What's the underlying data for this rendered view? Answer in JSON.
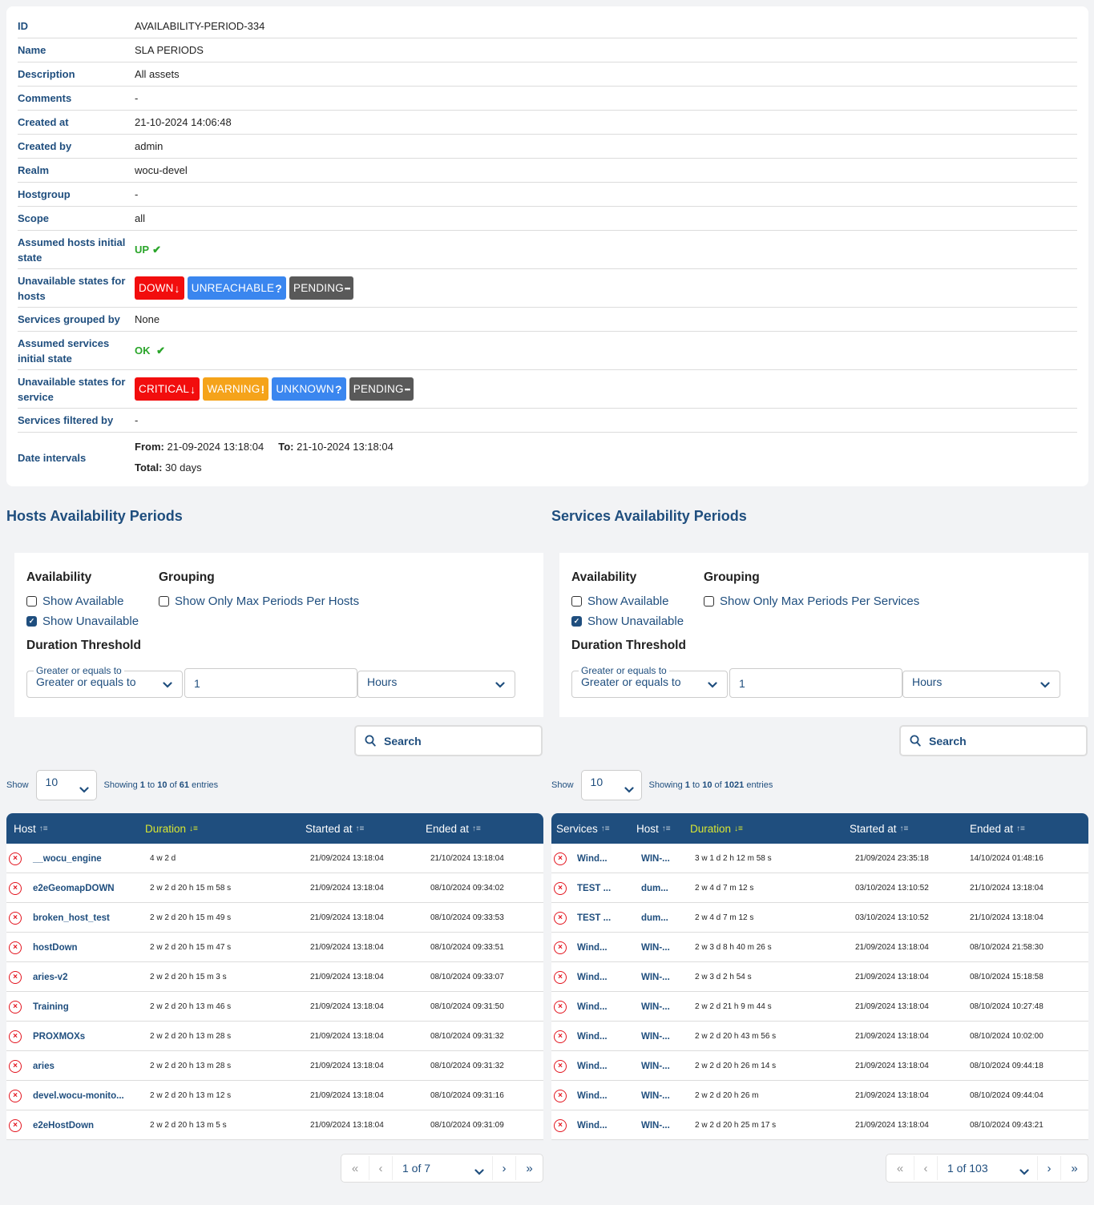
{
  "details": {
    "rows": [
      {
        "label": "ID",
        "value": "AVAILABILITY-PERIOD-334"
      },
      {
        "label": "Name",
        "value": "SLA PERIODS"
      },
      {
        "label": "Description",
        "value": "All assets"
      },
      {
        "label": "Comments",
        "value": "-"
      },
      {
        "label": "Created at",
        "value": "21-10-2024 14:06:48"
      },
      {
        "label": "Created by",
        "value": "admin"
      },
      {
        "label": "Realm",
        "value": "wocu-devel"
      },
      {
        "label": "Hostgroup",
        "value": "-"
      },
      {
        "label": "Scope",
        "value": "all"
      }
    ],
    "assumed_hosts_label": "Assumed hosts initial state",
    "assumed_hosts_value": "UP",
    "unavailable_hosts_label": "Unavailable states for hosts",
    "unavailable_hosts_badges": [
      {
        "label": "DOWN",
        "icon": "arrow-down-icon",
        "glyph": "↓",
        "color": "#f20d0d"
      },
      {
        "label": "UNREACHABLE",
        "icon": "question-icon",
        "glyph": "?",
        "color": "#3a86ef"
      },
      {
        "label": "PENDING",
        "icon": "ellipsis-icon",
        "glyph": "•••",
        "color": "#595959"
      }
    ],
    "services_grouped_label": "Services grouped by",
    "services_grouped_value": "None",
    "assumed_services_label": "Assumed services initial state",
    "assumed_services_value": "OK",
    "unavailable_services_label": "Unavailable states for service",
    "unavailable_services_badges": [
      {
        "label": "CRITICAL",
        "icon": "arrow-down-icon",
        "glyph": "↓",
        "color": "#f20d0d"
      },
      {
        "label": "WARNING",
        "icon": "exclamation-icon",
        "glyph": "!",
        "color": "#f5a31a"
      },
      {
        "label": "UNKNOWN",
        "icon": "question-icon",
        "glyph": "?",
        "color": "#3a86ef"
      },
      {
        "label": "PENDING",
        "icon": "ellipsis-icon",
        "glyph": "•••",
        "color": "#595959"
      }
    ],
    "services_filtered_label": "Services filtered by",
    "services_filtered_value": "-",
    "date_intervals_label": "Date intervals",
    "from_label": "From:",
    "from_value": "21-09-2024 13:18:04",
    "to_label": "To:",
    "to_value": "21-10-2024 13:18:04",
    "total_label": "Total:",
    "total_value": "30 days"
  },
  "hosts": {
    "title": "Hosts Availability Periods",
    "availability_heading": "Availability",
    "show_available": {
      "label": "Show Available",
      "checked": false
    },
    "show_unavailable": {
      "label": "Show Unavailable",
      "checked": true
    },
    "grouping_heading": "Grouping",
    "max_periods": {
      "label": "Show Only Max Periods Per Hosts",
      "checked": false
    },
    "duration_heading": "Duration Threshold",
    "operator_legend": "Greater or equals to",
    "operator_value": "Greater or equals to",
    "threshold_value": "1",
    "unit_value": "Hours",
    "search_label": "Search",
    "show_label": "Show",
    "page_size": "10",
    "showing_prefix": "Showing",
    "showing_from": "1",
    "showing_to_word": "to",
    "showing_to": "10",
    "showing_of_word": "of",
    "showing_total": "61",
    "showing_suffix": "entries",
    "columns": [
      "Host",
      "Duration",
      "Started at",
      "Ended at"
    ],
    "sorted_column": "Duration",
    "rows": [
      {
        "host": "__wocu_engine",
        "duration": "4 w 2 d",
        "started": "21/09/2024 13:18:04",
        "ended": "21/10/2024 13:18:04"
      },
      {
        "host": "e2eGeomapDOWN",
        "duration": "2 w 2 d 20 h 15 m 58 s",
        "started": "21/09/2024 13:18:04",
        "ended": "08/10/2024 09:34:02"
      },
      {
        "host": "broken_host_test",
        "duration": "2 w 2 d 20 h 15 m 49 s",
        "started": "21/09/2024 13:18:04",
        "ended": "08/10/2024 09:33:53"
      },
      {
        "host": "hostDown",
        "duration": "2 w 2 d 20 h 15 m 47 s",
        "started": "21/09/2024 13:18:04",
        "ended": "08/10/2024 09:33:51"
      },
      {
        "host": "aries-v2",
        "duration": "2 w 2 d 20 h 15 m 3 s",
        "started": "21/09/2024 13:18:04",
        "ended": "08/10/2024 09:33:07"
      },
      {
        "host": "Training",
        "duration": "2 w 2 d 20 h 13 m 46 s",
        "started": "21/09/2024 13:18:04",
        "ended": "08/10/2024 09:31:50"
      },
      {
        "host": "PROXMOXs",
        "duration": "2 w 2 d 20 h 13 m 28 s",
        "started": "21/09/2024 13:18:04",
        "ended": "08/10/2024 09:31:32"
      },
      {
        "host": "aries",
        "duration": "2 w 2 d 20 h 13 m 28 s",
        "started": "21/09/2024 13:18:04",
        "ended": "08/10/2024 09:31:32"
      },
      {
        "host": "devel.wocu-monito...",
        "duration": "2 w 2 d 20 h 13 m 12 s",
        "started": "21/09/2024 13:18:04",
        "ended": "08/10/2024 09:31:16"
      },
      {
        "host": "e2eHostDown",
        "duration": "2 w 2 d 20 h 13 m 5 s",
        "started": "21/09/2024 13:18:04",
        "ended": "08/10/2024 09:31:09"
      }
    ],
    "pager": {
      "current": "1 of 7"
    }
  },
  "services": {
    "title": "Services Availability Periods",
    "availability_heading": "Availability",
    "show_available": {
      "label": "Show Available",
      "checked": false
    },
    "show_unavailable": {
      "label": "Show Unavailable",
      "checked": true
    },
    "grouping_heading": "Grouping",
    "max_periods": {
      "label": "Show Only Max Periods Per Services",
      "checked": false
    },
    "duration_heading": "Duration Threshold",
    "operator_legend": "Greater or equals to",
    "operator_value": "Greater or equals to",
    "threshold_value": "1",
    "unit_value": "Hours",
    "search_label": "Search",
    "show_label": "Show",
    "page_size": "10",
    "showing_prefix": "Showing",
    "showing_from": "1",
    "showing_to_word": "to",
    "showing_to": "10",
    "showing_of_word": "of",
    "showing_total": "1021",
    "showing_suffix": "entries",
    "columns": [
      "Services",
      "Host",
      "Duration",
      "Started at",
      "Ended at"
    ],
    "sorted_column": "Duration",
    "rows": [
      {
        "service": "Wind...",
        "host": "WIN-...",
        "duration": "3 w 1 d 2 h 12 m 58 s",
        "started": "21/09/2024 23:35:18",
        "ended": "14/10/2024 01:48:16"
      },
      {
        "service": "TEST ...",
        "host": "dum...",
        "duration": "2 w 4 d 7 m 12 s",
        "started": "03/10/2024 13:10:52",
        "ended": "21/10/2024 13:18:04"
      },
      {
        "service": "TEST ...",
        "host": "dum...",
        "duration": "2 w 4 d 7 m 12 s",
        "started": "03/10/2024 13:10:52",
        "ended": "21/10/2024 13:18:04"
      },
      {
        "service": "Wind...",
        "host": "WIN-...",
        "duration": "2 w 3 d 8 h 40 m 26 s",
        "started": "21/09/2024 13:18:04",
        "ended": "08/10/2024 21:58:30"
      },
      {
        "service": "Wind...",
        "host": "WIN-...",
        "duration": "2 w 3 d 2 h 54 s",
        "started": "21/09/2024 13:18:04",
        "ended": "08/10/2024 15:18:58"
      },
      {
        "service": "Wind...",
        "host": "WIN-...",
        "duration": "2 w 2 d 21 h 9 m 44 s",
        "started": "21/09/2024 13:18:04",
        "ended": "08/10/2024 10:27:48"
      },
      {
        "service": "Wind...",
        "host": "WIN-...",
        "duration": "2 w 2 d 20 h 43 m 56 s",
        "started": "21/09/2024 13:18:04",
        "ended": "08/10/2024 10:02:00"
      },
      {
        "service": "Wind...",
        "host": "WIN-...",
        "duration": "2 w 2 d 20 h 26 m 14 s",
        "started": "21/09/2024 13:18:04",
        "ended": "08/10/2024 09:44:18"
      },
      {
        "service": "Wind...",
        "host": "WIN-...",
        "duration": "2 w 2 d 20 h 26 m",
        "started": "21/09/2024 13:18:04",
        "ended": "08/10/2024 09:44:04"
      },
      {
        "service": "Wind...",
        "host": "WIN-...",
        "duration": "2 w 2 d 20 h 25 m 17 s",
        "started": "21/09/2024 13:18:04",
        "ended": "08/10/2024 09:43:21"
      }
    ],
    "pager": {
      "current": "1 of 103"
    }
  }
}
